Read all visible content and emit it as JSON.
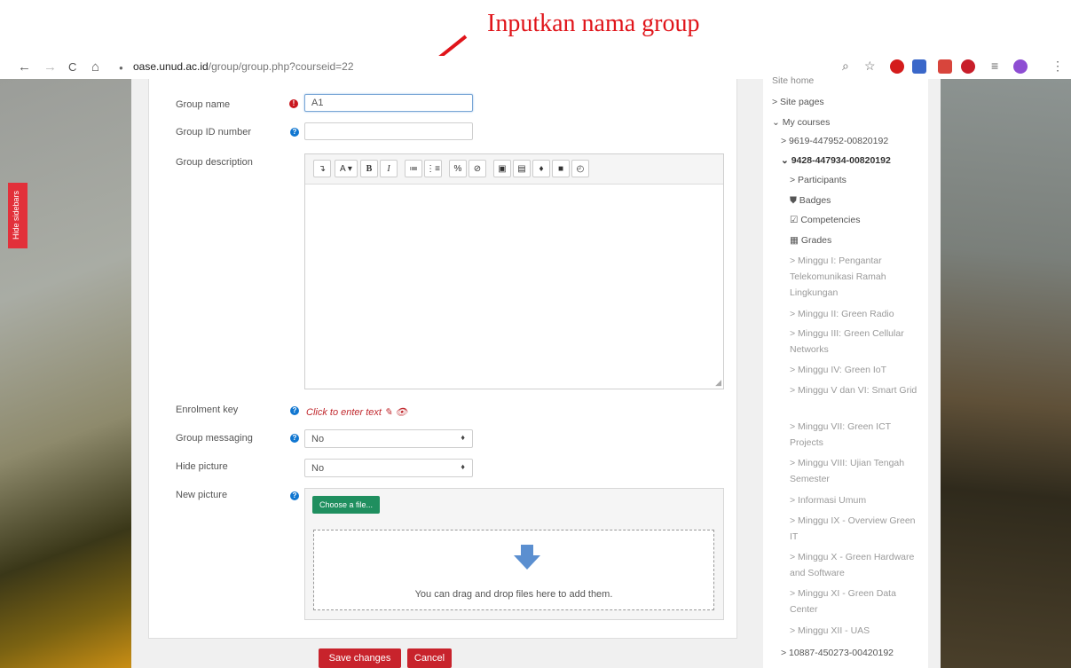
{
  "annotation": {
    "text": "Inputkan nama group",
    "color": "#e0141a"
  },
  "browser": {
    "url_host": "oase.unud.ac.id",
    "url_path": "/group/group.php?courseid=22",
    "nav": {
      "back": "←",
      "forward": "→",
      "reload": "C",
      "home": "⌂",
      "lock": "●"
    }
  },
  "hide_sidebars": "Hide sidebars",
  "form": {
    "group_name": {
      "label": "Group name",
      "value": "A1",
      "required_icon": "!"
    },
    "group_id": {
      "label": "Group ID number",
      "value": "",
      "help_icon": "?"
    },
    "group_description": {
      "label": "Group description",
      "help_icon": "?"
    },
    "toolbar": [
      "↴",
      "A ▾",
      "B",
      "I",
      "≔",
      "⋮≡",
      "%",
      "⊘",
      "▣",
      "▤",
      "♦",
      "■",
      "◴"
    ],
    "enrolment_key": {
      "label": "Enrolment key",
      "link": "Click to enter text ✎ 👁",
      "help_icon": "?"
    },
    "group_messaging": {
      "label": "Group messaging",
      "value": "No",
      "help_icon": "?"
    },
    "hide_picture": {
      "label": "Hide picture",
      "value": "No"
    },
    "new_picture": {
      "label": "New picture",
      "choose": "Choose a file...",
      "drop": "You can drag and drop files here to add them.",
      "help_icon": "?"
    },
    "save": "Save changes",
    "cancel": "Cancel",
    "caret": "♦"
  },
  "sidebar": {
    "items": [
      "Site home",
      "> Site pages",
      "⌄ My courses",
      "> 9619-447952-00820192",
      "⌄ 9428-447934-00820192",
      "> Participants",
      "⛊ Badges",
      "☑ Competencies",
      "▦ Grades",
      "> Minggu I: Pengantar Telekomunikasi Ramah Lingkungan",
      "> Minggu II: Green Radio",
      "> Minggu III: Green Cellular Networks",
      "> Minggu IV: Green IoT",
      "> Minggu V dan VI: Smart Grid",
      "> Minggu VII: Green ICT Projects",
      "> Minggu VIII: Ujian Tengah Semester",
      "> Informasi Umum",
      "> Minggu IX - Overview Green IT",
      "> Minggu X - Green Hardware and Software",
      "> Minggu XI - Green Data Center",
      "> Minggu XII - UAS",
      "> 10887-450273-00420192"
    ]
  }
}
